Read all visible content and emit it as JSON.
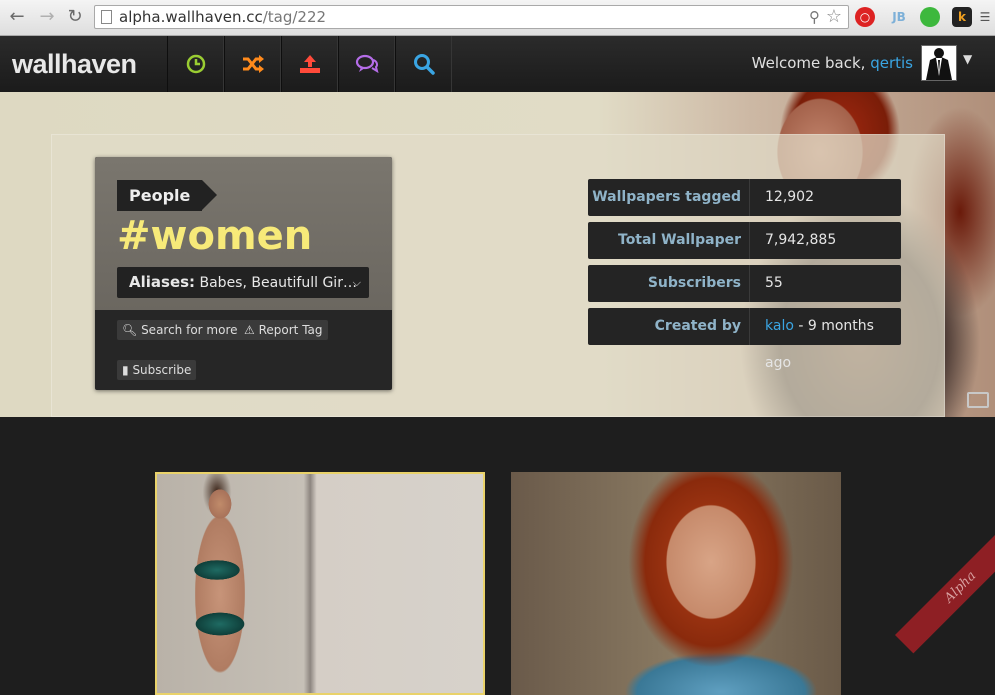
{
  "browser": {
    "url_host": "alpha.wallhaven.cc",
    "url_path": "/tag/222"
  },
  "header": {
    "logo": "wallhaven",
    "nav": [
      {
        "name": "latest",
        "icon": "clock-icon",
        "color": "#9acd32"
      },
      {
        "name": "random",
        "icon": "shuffle-icon",
        "color": "#ff8a1c"
      },
      {
        "name": "upload",
        "icon": "upload-icon",
        "color": "#ff4a3a"
      },
      {
        "name": "forums",
        "icon": "chat-icon",
        "color": "#b56de8"
      },
      {
        "name": "search",
        "icon": "search-icon",
        "color": "#3aa5e3"
      }
    ],
    "welcome_text": "Welcome back, ",
    "username": "qertis"
  },
  "tag": {
    "category": "People",
    "name": "#women",
    "aliases_label": "Aliases:",
    "aliases_value": " Babes, Beautifull Gir…",
    "search_label": "Search for more",
    "report_label": "Report Tag",
    "subscribe_label": "Subscribe"
  },
  "stats": [
    {
      "label": "Wallpapers tagged",
      "value": "12,902"
    },
    {
      "label": "Total Wallpaper Views",
      "value": "7,942,885"
    },
    {
      "label": "Subscribers",
      "value": "55"
    },
    {
      "label": "Created by",
      "link": "kalo",
      "suffix": " - 9 months ago"
    }
  ],
  "ribbon": "Alpha",
  "colors": {
    "accent": "#3aa5e3",
    "tag_yellow": "#f7ea79",
    "selected_border": "#e9d26a",
    "ribbon": "#8e1f24"
  }
}
